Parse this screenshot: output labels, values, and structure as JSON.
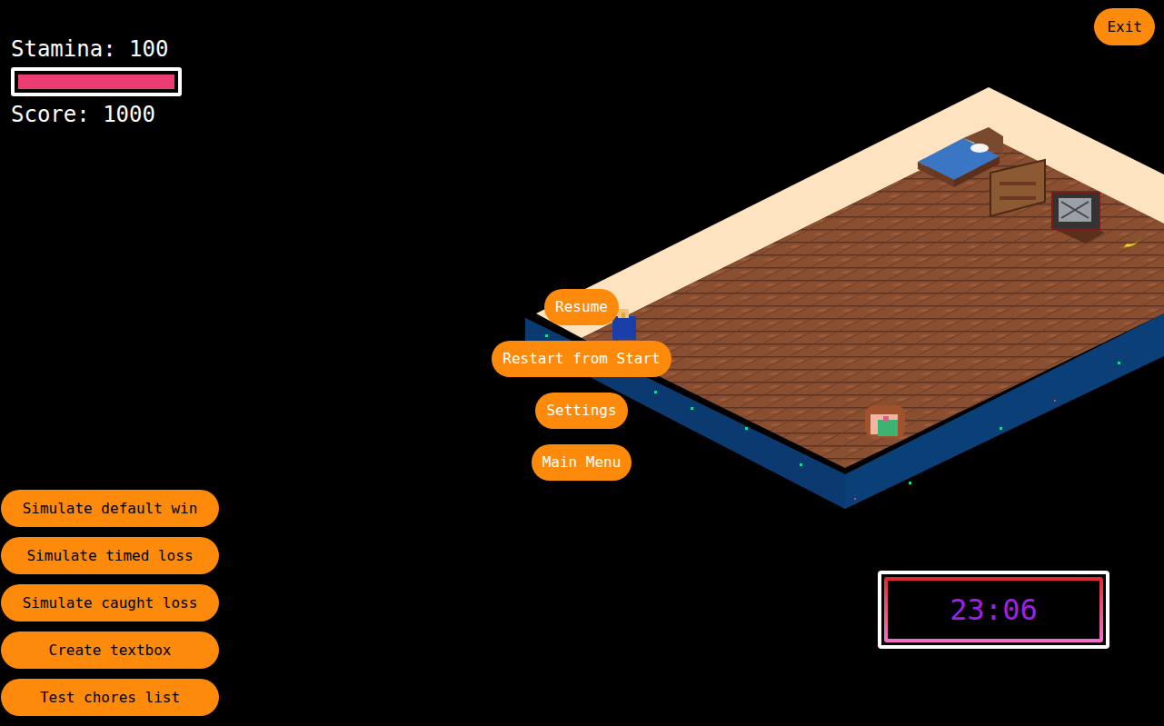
{
  "hud": {
    "stamina": {
      "label": "Stamina: 100",
      "level": 1
    },
    "score": "Score: 1000"
  },
  "exit_button": "Exit",
  "pause_menu": {
    "buttons": [
      "Resume",
      "Restart from Start",
      "Settings",
      "Main Menu"
    ]
  },
  "debug_buttons": [
    "Simulate default win",
    "Simulate timed loss",
    "Simulate caught loss",
    "Create textbox",
    "Test chores list"
  ],
  "timer": "23:06"
}
